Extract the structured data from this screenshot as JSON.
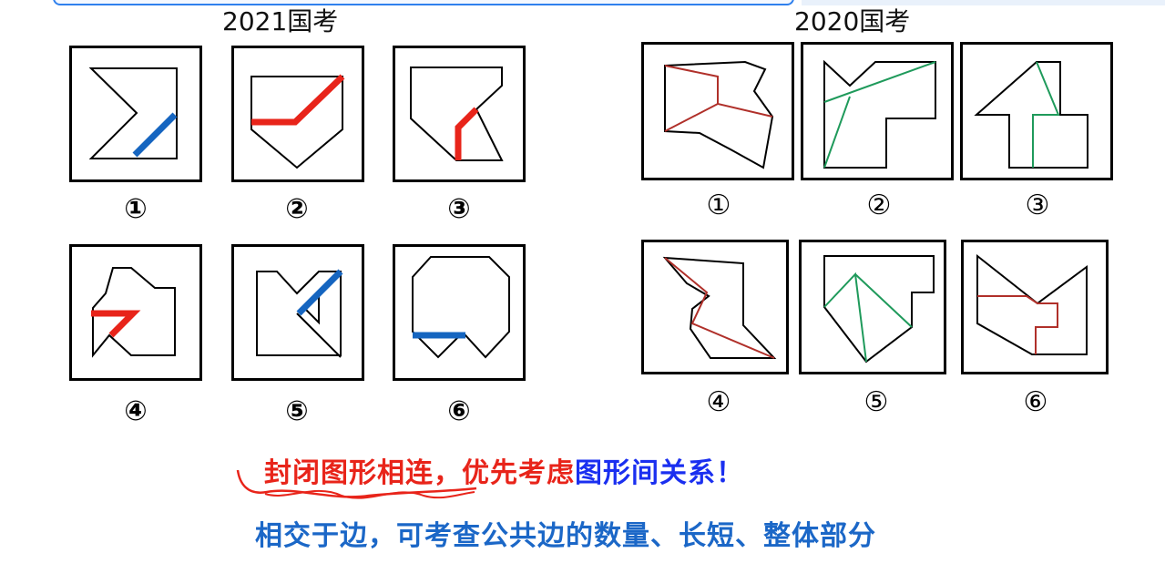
{
  "left_heading": "2021国考",
  "right_heading": "2020国考",
  "left_labels": [
    "①",
    "②",
    "③",
    "④",
    "⑤",
    "⑥"
  ],
  "right_labels": [
    "①",
    "②",
    "③",
    "④",
    "⑤",
    "⑥"
  ],
  "colors": {
    "red": "#e8241a",
    "blue": "#1565c0",
    "green": "#1f9a5b",
    "darkred": "#b0302a"
  },
  "caption": {
    "line1_red": "封闭图形相连，优先考虑",
    "line1_blue": "图形间关系！",
    "line2": "相交于边，可考查公共边的数量、长短、整体部分"
  }
}
